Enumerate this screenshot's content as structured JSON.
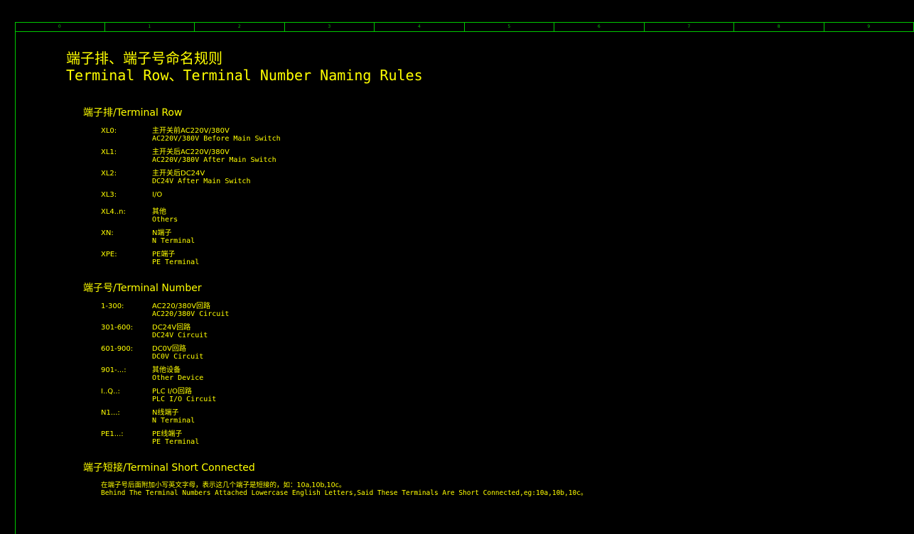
{
  "ruler": [
    "0",
    "1",
    "2",
    "3",
    "4",
    "5",
    "6",
    "7",
    "8",
    "9"
  ],
  "title": {
    "cn": "端子排、端子号命名规则",
    "en": "Terminal Row、Terminal Number Naming Rules"
  },
  "terminal_row": {
    "heading": "端子排/Terminal Row",
    "items": [
      {
        "code": "XL0:",
        "cn": "主开关前AC220V/380V",
        "en": "AC220V/380V Before Main Switch"
      },
      {
        "code": "XL1:",
        "cn": "主开关后AC220V/380V",
        "en": "AC220V/380V After Main Switch"
      },
      {
        "code": "XL2:",
        "cn": "主开关后DC24V",
        "en": "DC24V After Main Switch"
      },
      {
        "code": "XL3:",
        "cn": "I/O",
        "en": ""
      },
      {
        "code": "XL4..n:",
        "cn": "其他",
        "en": "Others"
      },
      {
        "code": "XN:",
        "cn": "N端子",
        "en": "N Terminal"
      },
      {
        "code": "XPE:",
        "cn": "PE端子",
        "en": "PE Terminal"
      }
    ]
  },
  "terminal_number": {
    "heading": "端子号/Terminal Number",
    "items": [
      {
        "code": "1-300:",
        "cn": "AC220/380V回路",
        "en": "AC220/380V Circuit"
      },
      {
        "code": "301-600:",
        "cn": "DC24V回路",
        "en": "DC24V Circuit"
      },
      {
        "code": "601-900:",
        "cn": "DC0V回路",
        "en": "DC0V Circuit"
      },
      {
        "code": "901-...:",
        "cn": "其他设备",
        "en": "Other Device"
      },
      {
        "code": "I..Q..:",
        "cn": "PLC I/O回路",
        "en": "PLC I/O Circuit"
      },
      {
        "code": "N1...:",
        "cn": "N线端子",
        "en": "N Terminal"
      },
      {
        "code": "PE1...:",
        "cn": "PE线端子",
        "en": "PE Terminal"
      }
    ]
  },
  "short_connected": {
    "heading": "端子短接/Terminal Short Connected",
    "cn": "在端子号后面附加小写英文字母，表示这几个端子是短接的，如：10a,10b,10c。",
    "en": "Behind The Terminal Numbers Attached Lowercase English Letters,Said These Terminals Are Short Connected,eg:10a,10b,10c。"
  },
  "colors": {
    "background": "#000000",
    "text": "#ffff00",
    "frame": "#00c800"
  }
}
